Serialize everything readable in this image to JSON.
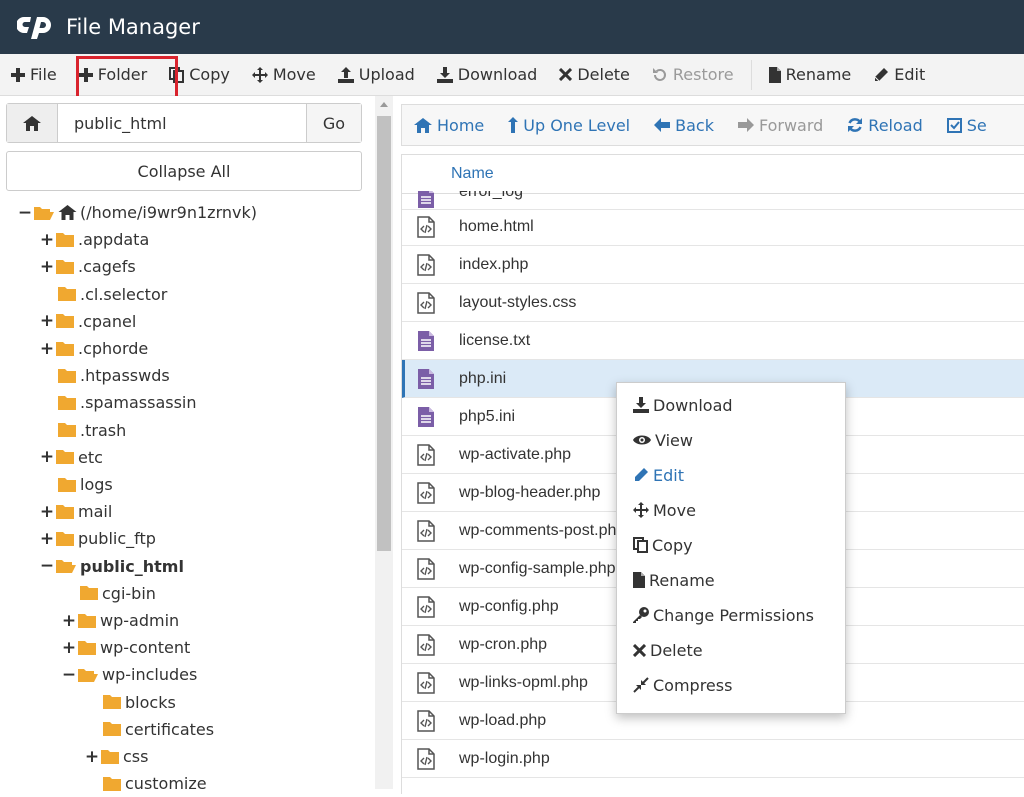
{
  "header": {
    "title": "File Manager"
  },
  "toolbar": {
    "items": [
      {
        "label": "File",
        "icon": "plus-icon"
      },
      {
        "label": "Folder",
        "icon": "plus-icon"
      },
      {
        "label": "Copy",
        "icon": "copy-icon"
      },
      {
        "label": "Move",
        "icon": "move-icon"
      },
      {
        "label": "Upload",
        "icon": "upload-icon"
      },
      {
        "label": "Download",
        "icon": "download-icon"
      },
      {
        "label": "Delete",
        "icon": "close-icon"
      },
      {
        "label": "Restore",
        "icon": "restore-icon"
      },
      {
        "label": "Rename",
        "icon": "file-icon"
      },
      {
        "label": "Edit",
        "icon": "pencil-icon"
      }
    ]
  },
  "sidebar": {
    "path_value": "public_html",
    "go_label": "Go",
    "collapse_label": "Collapse All",
    "tree": [
      {
        "label": "(/home/i9wr9n1zrnvk)",
        "toggle": "−",
        "open": true
      },
      {
        "label": ".appdata",
        "toggle": "+"
      },
      {
        "label": ".cagefs",
        "toggle": "+"
      },
      {
        "label": ".cl.selector",
        "toggle": ""
      },
      {
        "label": ".cpanel",
        "toggle": "+"
      },
      {
        "label": ".cphorde",
        "toggle": "+"
      },
      {
        "label": ".htpasswds",
        "toggle": ""
      },
      {
        "label": ".spamassassin",
        "toggle": ""
      },
      {
        "label": ".trash",
        "toggle": ""
      },
      {
        "label": "etc",
        "toggle": "+"
      },
      {
        "label": "logs",
        "toggle": ""
      },
      {
        "label": "mail",
        "toggle": "+"
      },
      {
        "label": "public_ftp",
        "toggle": "+"
      },
      {
        "label": "public_html",
        "toggle": "−",
        "open": true,
        "bold": true
      },
      {
        "label": "cgi-bin",
        "toggle": ""
      },
      {
        "label": "wp-admin",
        "toggle": "+"
      },
      {
        "label": "wp-content",
        "toggle": "+"
      },
      {
        "label": "wp-includes",
        "toggle": "−",
        "open": true
      },
      {
        "label": "blocks",
        "toggle": ""
      },
      {
        "label": "certificates",
        "toggle": ""
      },
      {
        "label": "css",
        "toggle": "+"
      },
      {
        "label": "customize",
        "toggle": ""
      }
    ]
  },
  "navbar": {
    "items": [
      {
        "label": "Home",
        "icon": "home-icon"
      },
      {
        "label": "Up One Level",
        "icon": "arrow-up-icon"
      },
      {
        "label": "Back",
        "icon": "arrow-left-icon"
      },
      {
        "label": "Forward",
        "icon": "arrow-right-icon"
      },
      {
        "label": "Reload",
        "icon": "reload-icon"
      },
      {
        "label": "Se",
        "icon": "checkbox-icon"
      }
    ]
  },
  "files": {
    "column_name": "Name",
    "rows": [
      {
        "name": "error_log",
        "type": "text"
      },
      {
        "name": "home.html",
        "type": "code"
      },
      {
        "name": "index.php",
        "type": "code"
      },
      {
        "name": "layout-styles.css",
        "type": "code"
      },
      {
        "name": "license.txt",
        "type": "text"
      },
      {
        "name": "php.ini",
        "type": "text",
        "selected": true
      },
      {
        "name": "php5.ini",
        "type": "text"
      },
      {
        "name": "wp-activate.php",
        "type": "code"
      },
      {
        "name": "wp-blog-header.php",
        "type": "code"
      },
      {
        "name": "wp-comments-post.php",
        "type": "code"
      },
      {
        "name": "wp-config-sample.php",
        "type": "code"
      },
      {
        "name": "wp-config.php",
        "type": "code"
      },
      {
        "name": "wp-cron.php",
        "type": "code"
      },
      {
        "name": "wp-links-opml.php",
        "type": "code"
      },
      {
        "name": "wp-load.php",
        "type": "code"
      },
      {
        "name": "wp-login.php",
        "type": "code"
      }
    ]
  },
  "context_menu": {
    "items": [
      {
        "label": "Download",
        "icon": "download-icon"
      },
      {
        "label": "View",
        "icon": "eye-icon"
      },
      {
        "label": "Edit",
        "icon": "pencil-icon"
      },
      {
        "label": "Move",
        "icon": "move-icon"
      },
      {
        "label": "Copy",
        "icon": "copy-icon"
      },
      {
        "label": "Rename",
        "icon": "file-icon"
      },
      {
        "label": "Change Permissions",
        "icon": "key-icon"
      },
      {
        "label": "Delete",
        "icon": "close-icon"
      },
      {
        "label": "Compress",
        "icon": "compress-icon"
      }
    ]
  },
  "colors": {
    "header_bg": "#293a4a",
    "accent": "#2f74b5",
    "highlight": "#d9232d",
    "folder": "#f0a830",
    "file_text_icon": "#7b5ea7"
  }
}
